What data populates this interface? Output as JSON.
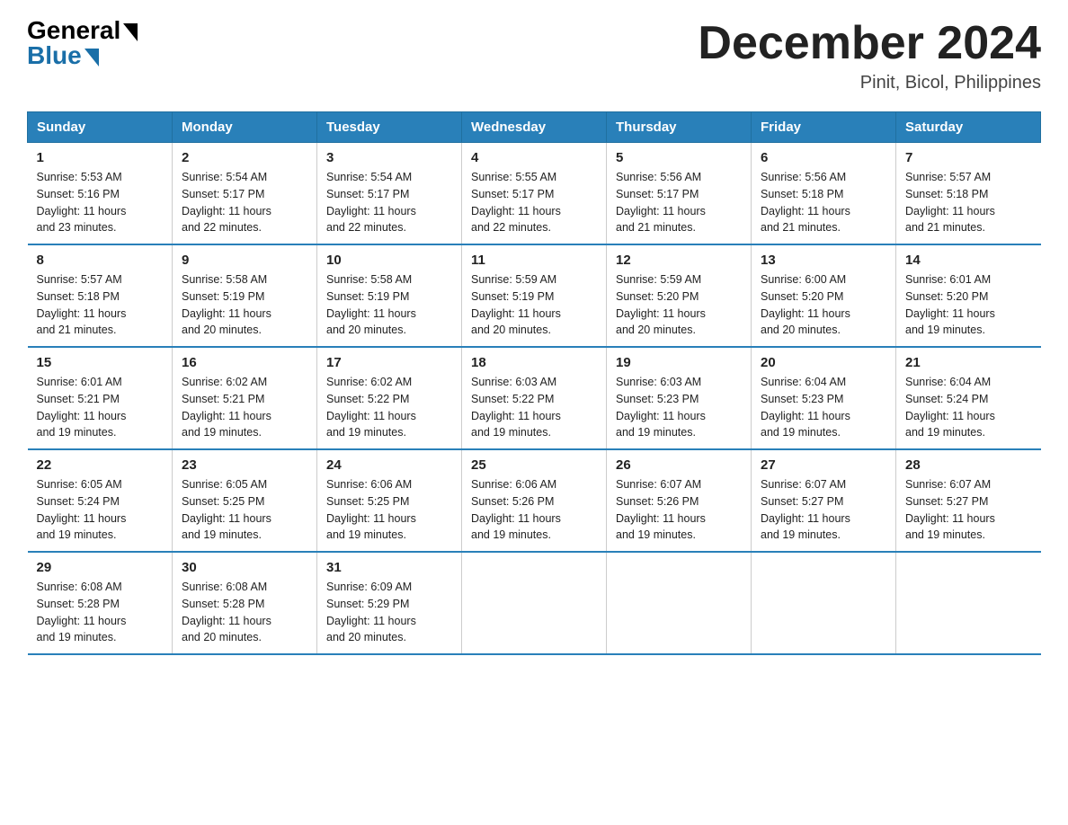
{
  "logo": {
    "general": "General",
    "blue": "Blue"
  },
  "title": "December 2024",
  "location": "Pinit, Bicol, Philippines",
  "headers": [
    "Sunday",
    "Monday",
    "Tuesday",
    "Wednesday",
    "Thursday",
    "Friday",
    "Saturday"
  ],
  "weeks": [
    [
      {
        "day": "1",
        "sunrise": "5:53 AM",
        "sunset": "5:16 PM",
        "daylight": "11 hours and 23 minutes."
      },
      {
        "day": "2",
        "sunrise": "5:54 AM",
        "sunset": "5:17 PM",
        "daylight": "11 hours and 22 minutes."
      },
      {
        "day": "3",
        "sunrise": "5:54 AM",
        "sunset": "5:17 PM",
        "daylight": "11 hours and 22 minutes."
      },
      {
        "day": "4",
        "sunrise": "5:55 AM",
        "sunset": "5:17 PM",
        "daylight": "11 hours and 22 minutes."
      },
      {
        "day": "5",
        "sunrise": "5:56 AM",
        "sunset": "5:17 PM",
        "daylight": "11 hours and 21 minutes."
      },
      {
        "day": "6",
        "sunrise": "5:56 AM",
        "sunset": "5:18 PM",
        "daylight": "11 hours and 21 minutes."
      },
      {
        "day": "7",
        "sunrise": "5:57 AM",
        "sunset": "5:18 PM",
        "daylight": "11 hours and 21 minutes."
      }
    ],
    [
      {
        "day": "8",
        "sunrise": "5:57 AM",
        "sunset": "5:18 PM",
        "daylight": "11 hours and 21 minutes."
      },
      {
        "day": "9",
        "sunrise": "5:58 AM",
        "sunset": "5:19 PM",
        "daylight": "11 hours and 20 minutes."
      },
      {
        "day": "10",
        "sunrise": "5:58 AM",
        "sunset": "5:19 PM",
        "daylight": "11 hours and 20 minutes."
      },
      {
        "day": "11",
        "sunrise": "5:59 AM",
        "sunset": "5:19 PM",
        "daylight": "11 hours and 20 minutes."
      },
      {
        "day": "12",
        "sunrise": "5:59 AM",
        "sunset": "5:20 PM",
        "daylight": "11 hours and 20 minutes."
      },
      {
        "day": "13",
        "sunrise": "6:00 AM",
        "sunset": "5:20 PM",
        "daylight": "11 hours and 20 minutes."
      },
      {
        "day": "14",
        "sunrise": "6:01 AM",
        "sunset": "5:20 PM",
        "daylight": "11 hours and 19 minutes."
      }
    ],
    [
      {
        "day": "15",
        "sunrise": "6:01 AM",
        "sunset": "5:21 PM",
        "daylight": "11 hours and 19 minutes."
      },
      {
        "day": "16",
        "sunrise": "6:02 AM",
        "sunset": "5:21 PM",
        "daylight": "11 hours and 19 minutes."
      },
      {
        "day": "17",
        "sunrise": "6:02 AM",
        "sunset": "5:22 PM",
        "daylight": "11 hours and 19 minutes."
      },
      {
        "day": "18",
        "sunrise": "6:03 AM",
        "sunset": "5:22 PM",
        "daylight": "11 hours and 19 minutes."
      },
      {
        "day": "19",
        "sunrise": "6:03 AM",
        "sunset": "5:23 PM",
        "daylight": "11 hours and 19 minutes."
      },
      {
        "day": "20",
        "sunrise": "6:04 AM",
        "sunset": "5:23 PM",
        "daylight": "11 hours and 19 minutes."
      },
      {
        "day": "21",
        "sunrise": "6:04 AM",
        "sunset": "5:24 PM",
        "daylight": "11 hours and 19 minutes."
      }
    ],
    [
      {
        "day": "22",
        "sunrise": "6:05 AM",
        "sunset": "5:24 PM",
        "daylight": "11 hours and 19 minutes."
      },
      {
        "day": "23",
        "sunrise": "6:05 AM",
        "sunset": "5:25 PM",
        "daylight": "11 hours and 19 minutes."
      },
      {
        "day": "24",
        "sunrise": "6:06 AM",
        "sunset": "5:25 PM",
        "daylight": "11 hours and 19 minutes."
      },
      {
        "day": "25",
        "sunrise": "6:06 AM",
        "sunset": "5:26 PM",
        "daylight": "11 hours and 19 minutes."
      },
      {
        "day": "26",
        "sunrise": "6:07 AM",
        "sunset": "5:26 PM",
        "daylight": "11 hours and 19 minutes."
      },
      {
        "day": "27",
        "sunrise": "6:07 AM",
        "sunset": "5:27 PM",
        "daylight": "11 hours and 19 minutes."
      },
      {
        "day": "28",
        "sunrise": "6:07 AM",
        "sunset": "5:27 PM",
        "daylight": "11 hours and 19 minutes."
      }
    ],
    [
      {
        "day": "29",
        "sunrise": "6:08 AM",
        "sunset": "5:28 PM",
        "daylight": "11 hours and 19 minutes."
      },
      {
        "day": "30",
        "sunrise": "6:08 AM",
        "sunset": "5:28 PM",
        "daylight": "11 hours and 20 minutes."
      },
      {
        "day": "31",
        "sunrise": "6:09 AM",
        "sunset": "5:29 PM",
        "daylight": "11 hours and 20 minutes."
      },
      null,
      null,
      null,
      null
    ]
  ],
  "sunrise_label": "Sunrise:",
  "sunset_label": "Sunset:",
  "daylight_label": "Daylight:"
}
